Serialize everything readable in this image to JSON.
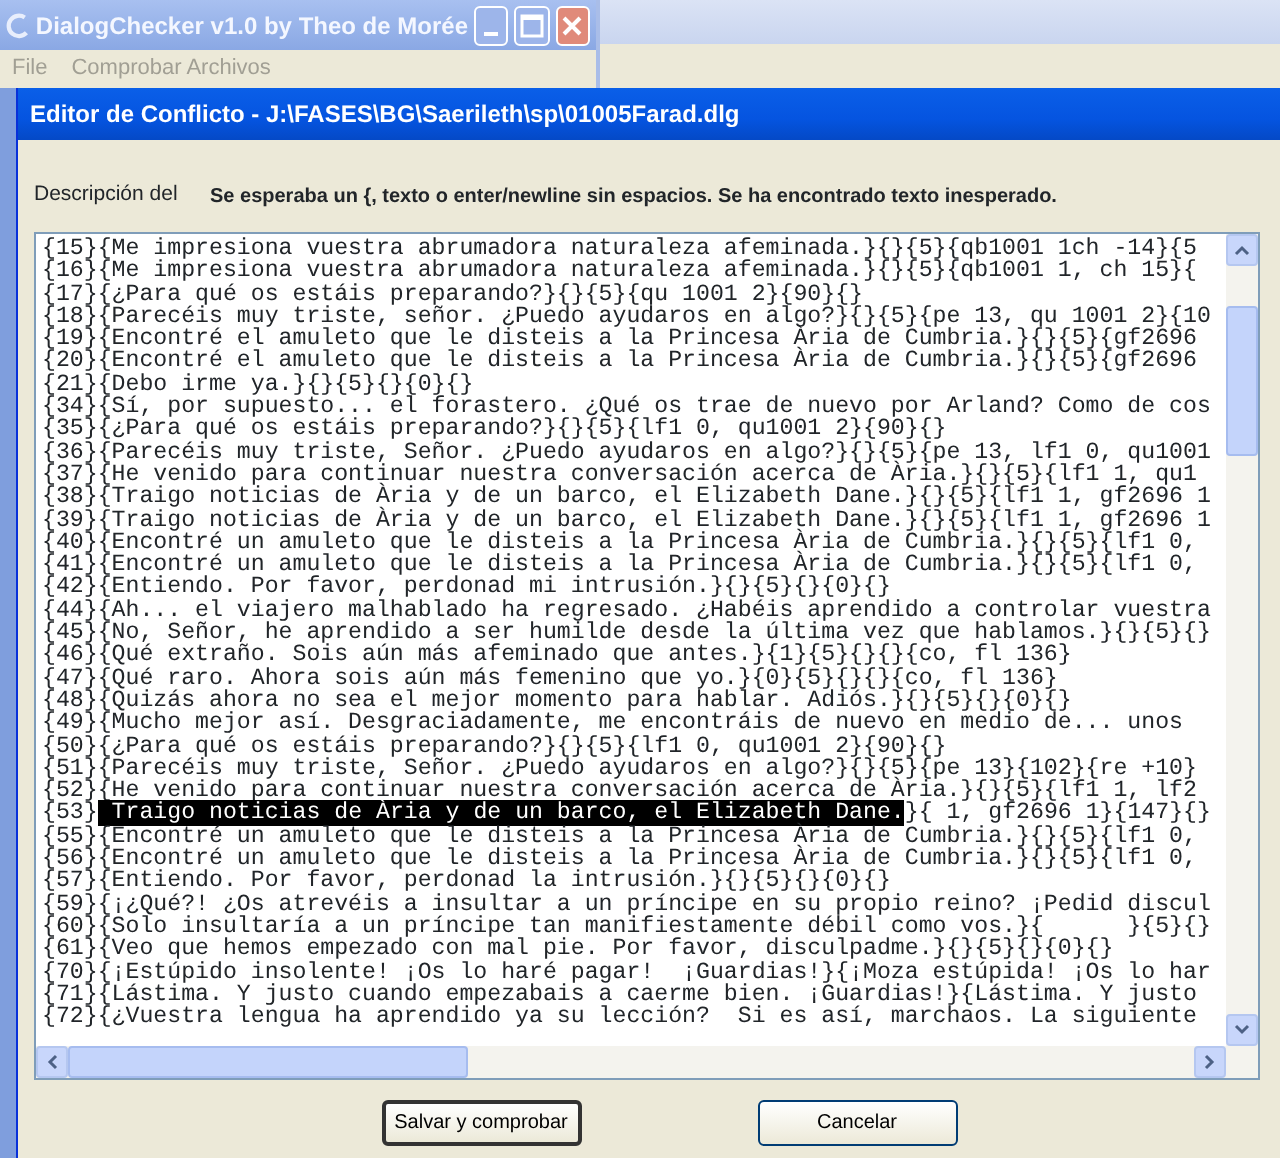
{
  "main_window": {
    "title": "DialogChecker v1.0 by Theo de Morée",
    "menu": [
      "File",
      "Comprobar Archivos"
    ]
  },
  "dialog": {
    "title": "Editor de Conflicto - J:\\FASES\\BG\\Saerileth\\sp\\01005Farad.dlg",
    "description_label": "Descripción del",
    "description": "Se esperaba un {, texto o enter/newline sin espacios. Se ha encontrado texto inesperado.",
    "lines": [
      {
        "kind": "plain",
        "text": "{15}{Me impresiona vuestra abrumadora naturaleza afeminada.}{}{5}{qb1001 1ch -14}{5"
      },
      {
        "kind": "plain",
        "text": "{16}{Me impresiona vuestra abrumadora naturaleza afeminada.}{}{5}{qb1001 1, ch 15}{"
      },
      {
        "kind": "plain",
        "text": "{17}{¿Para qué os estáis preparando?}{}{5}{qu 1001 2}{90}{}"
      },
      {
        "kind": "plain",
        "text": "{18}{Parecéis muy triste, señor. ¿Puedo ayudaros en algo?}{}{5}{pe 13, qu 1001 2}{10"
      },
      {
        "kind": "plain",
        "text": "{19}{Encontré el amuleto que le disteis a la Princesa Ària de Cumbria.}{}{5}{gf2696"
      },
      {
        "kind": "plain",
        "text": "{20}{Encontré el amuleto que le disteis a la Princesa Ària de Cumbria.}{}{5}{gf2696"
      },
      {
        "kind": "plain",
        "text": "{21}{Debo irme ya.}{}{5}{}{0}{}"
      },
      {
        "kind": "plain",
        "text": "{34}{Sí, por supuesto... el forastero. ¿Qué os trae de nuevo por Arland? Como de cos"
      },
      {
        "kind": "plain",
        "text": "{35}{¿Para qué os estáis preparando?}{}{5}{lf1 0, qu1001 2}{90}{}"
      },
      {
        "kind": "plain",
        "text": "{36}{Parecéis muy triste, Señor. ¿Puedo ayudaros en algo?}{}{5}{pe 13, lf1 0, qu1001"
      },
      {
        "kind": "plain",
        "text": "{37}{He venido para continuar nuestra conversación acerca de Ària.}{}{5}{lf1 1, qu1"
      },
      {
        "kind": "plain",
        "text": "{38}{Traigo noticias de Ària y de un barco, el Elizabeth Dane.}{}{5}{lf1 1, gf2696 1"
      },
      {
        "kind": "plain",
        "text": "{39}{Traigo noticias de Ària y de un barco, el Elizabeth Dane.}{}{5}{lf1 1, gf2696 1"
      },
      {
        "kind": "plain",
        "text": "{40}{Encontré un amuleto que le disteis a la Princesa Ària de Cumbria.}{}{5}{lf1 0,"
      },
      {
        "kind": "plain",
        "text": "{41}{Encontré un amuleto que le disteis a la Princesa Ària de Cumbria.}{}{5}{lf1 0,"
      },
      {
        "kind": "plain",
        "text": "{42}{Entiendo. Por favor, perdonad mi intrusión.}{}{5}{}{0}{}"
      },
      {
        "kind": "plain",
        "text": "{44}{Ah... el viajero malhablado ha regresado. ¿Habéis aprendido a controlar vuestra"
      },
      {
        "kind": "plain",
        "text": "{45}{No, Señor, he aprendido a ser humilde desde la última vez que hablamos.}{}{5}{}"
      },
      {
        "kind": "plain",
        "text": "{46}{Qué extraño. Sois aún más afeminado que antes.}{1}{5}{}{}{co, fl 136}"
      },
      {
        "kind": "plain",
        "text": "{47}{Qué raro. Ahora sois aún más femenino que yo.}{0}{5}{}{}{co, fl 136}"
      },
      {
        "kind": "plain",
        "text": "{48}{Quizás ahora no sea el mejor momento para hablar. Adiós.}{}{5}{}{0}{}"
      },
      {
        "kind": "plain",
        "text": "{49}{Mucho mejor así. Desgraciadamente, me encontráis de nuevo en medio de... unos"
      },
      {
        "kind": "plain",
        "text": "{50}{¿Para qué os estáis preparando?}{}{5}{lf1 0, qu1001 2}{90}{}"
      },
      {
        "kind": "plain",
        "text": "{51}{Parecéis muy triste, Señor. ¿Puedo ayudaros en algo?}{}{5}{pe 13}{102}{re +10}"
      },
      {
        "kind": "plain",
        "text": "{52}{He venido para continuar nuestra conversación acerca de Ària.}{}{5}{lf1 1, lf2"
      },
      {
        "kind": "selection",
        "before": "{53}",
        "selected_text": " Traigo noticias de Ària y de un barco, el Elizabeth Dane.",
        "after": "}{ 1, gf2696 1}{147}{}"
      },
      {
        "kind": "plain",
        "text": "{55}{Encontré un amuleto que le disteis a la Princesa Ària de Cumbria.}{}{5}{lf1 0,"
      },
      {
        "kind": "plain",
        "text": "{56}{Encontré un amuleto que le disteis a la Princesa Ària de Cumbria.}{}{5}{lf1 0,"
      },
      {
        "kind": "plain",
        "text": "{57}{Entiendo. Por favor, perdonad la intrusión.}{}{5}{}{0}{}"
      },
      {
        "kind": "plain",
        "text": "{59}{¡¿Qué?! ¿Os atrevéis a insultar a un príncipe en su propio reino? ¡Pedid discul"
      },
      {
        "kind": "plain",
        "text": "{60}{Solo insultaría a un príncipe tan manifiestamente débil como vos.}{      }{5}{}"
      },
      {
        "kind": "plain",
        "text": "{61}{Veo que hemos empezado con mal pie. Por favor, disculpadme.}{}{5}{}{0}{}"
      },
      {
        "kind": "plain",
        "text": "{70}{¡Estúpido insolente! ¡Os lo haré pagar!  ¡Guardias!}{¡Moza estúpida! ¡Os lo har"
      },
      {
        "kind": "plain",
        "text": "{71}{Lástima. Y justo cuando empezabais a caerme bien. ¡Guardias!}{Lástima. Y justo"
      },
      {
        "kind": "plain",
        "text": "{72}{¿Vuestra lengua ha aprendido ya su lección?  Si es así, marchaos. La siguiente"
      }
    ],
    "buttons": [
      "Salvar y comprobar",
      "Cancelar"
    ]
  }
}
